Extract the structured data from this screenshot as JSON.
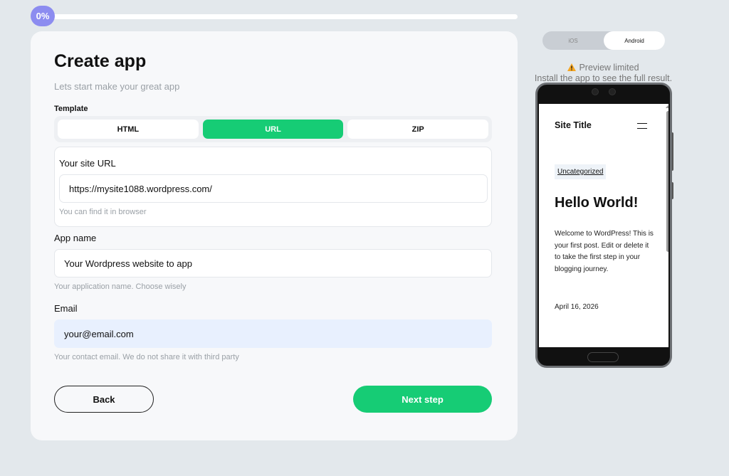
{
  "progress": {
    "label": "0%",
    "value": 0
  },
  "form": {
    "title": "Create app",
    "subtitle": "Lets start make your great app",
    "template_label": "Template",
    "tabs": [
      {
        "label": "HTML",
        "active": false
      },
      {
        "label": "URL",
        "active": true
      },
      {
        "label": "ZIP",
        "active": false
      }
    ],
    "site_url": {
      "label": "Your site URL",
      "value": "https://mysite1088.wordpress.com/",
      "help": "You can find it in browser"
    },
    "app_name": {
      "label": "App name",
      "value": "Your Wordpress website to app",
      "help": "Your application name. Choose wisely"
    },
    "email": {
      "label": "Email",
      "value": "your@email.com",
      "help": "Your contact email. We do not share it with third party"
    },
    "back_label": "Back",
    "next_label": "Next step"
  },
  "preview": {
    "platforms": [
      {
        "label": "iOS",
        "active": false
      },
      {
        "label": "Android",
        "active": true
      }
    ],
    "note_title": "Preview limited",
    "note_text": "Install the app to see the full result.",
    "site": {
      "site_title": "Site Title",
      "category": "Uncategorized",
      "post_title": "Hello World!",
      "post_body": "Welcome to WordPress! This is your first post. Edit or delete it to take the first step in your blogging journey.",
      "post_date": "April 16, 2026"
    }
  },
  "colors": {
    "accent": "#16cc75",
    "progress": "#8c8cf0",
    "background": "#e3e8ec",
    "warning": "#f5a623"
  },
  "icons": {
    "warning": "warning-icon",
    "menu": "hamburger-menu-icon"
  }
}
